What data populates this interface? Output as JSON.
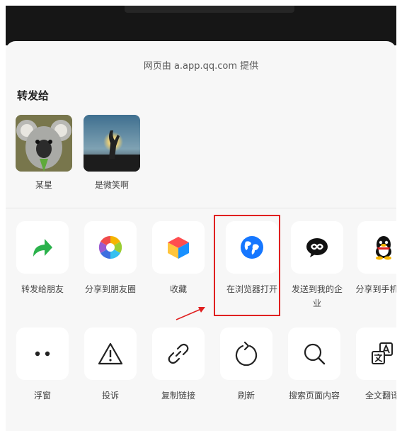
{
  "provider_text": "网页由 a.app.qq.com 提供",
  "share_to_title": "转发给",
  "contacts": [
    {
      "name": "某星",
      "avatar": "koala-photo"
    },
    {
      "name": "是微笑啊",
      "avatar": "sunset-hand-photo"
    }
  ],
  "actions_row1": [
    {
      "label": "转发给朋友",
      "icon": "forward-arrow-icon",
      "color": "#2bb24c"
    },
    {
      "label": "分享到朋友圈",
      "icon": "moments-shutter-icon"
    },
    {
      "label": "收藏",
      "icon": "favorites-cube-icon"
    },
    {
      "label": "在浏览器打开",
      "icon": "globe-icon",
      "color": "#1677ff"
    },
    {
      "label": "发送到我的企业",
      "icon": "wecom-icon"
    },
    {
      "label": "分享到手机QQ",
      "icon": "qq-penguin-icon"
    }
  ],
  "actions_row2": [
    {
      "label": "浮窗",
      "icon": "float-window-icon"
    },
    {
      "label": "投诉",
      "icon": "warning-icon"
    },
    {
      "label": "复制链接",
      "icon": "link-icon"
    },
    {
      "label": "刷新",
      "icon": "refresh-icon"
    },
    {
      "label": "搜索页面内容",
      "icon": "search-icon"
    },
    {
      "label": "全文翻译",
      "icon": "translate-icon"
    }
  ],
  "annotation_color": "#e02020"
}
